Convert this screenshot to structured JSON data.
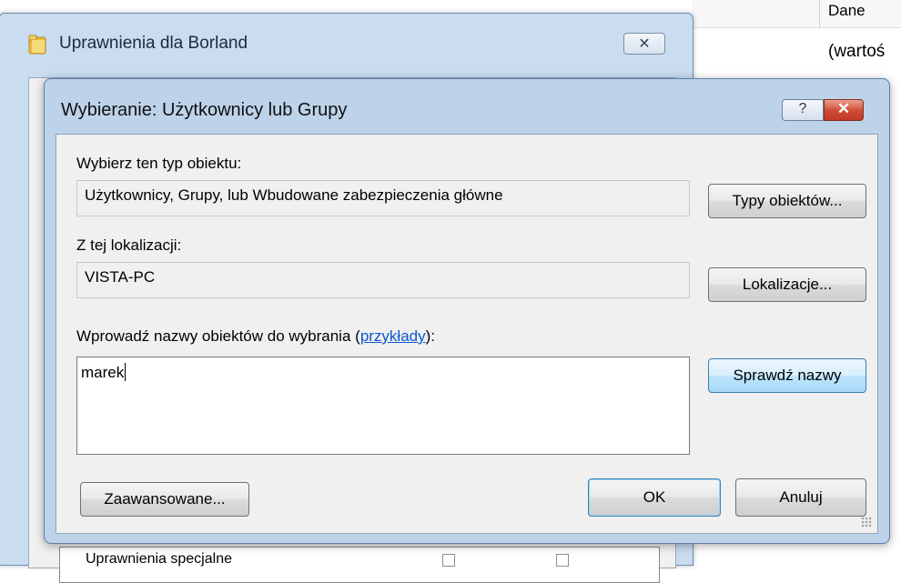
{
  "background_panel": {
    "column_header": "Dane",
    "cell_value": "(wartoś"
  },
  "back_window": {
    "title": "Uprawnienia dla Borland",
    "list_partial_item": "Uprawnienia specjalne"
  },
  "dialog": {
    "title": "Wybieranie: Użytkownicy lub Grupy",
    "object_type_label": "Wybierz ten typ obiektu:",
    "object_type_value": "Użytkownicy, Grupy, lub Wbudowane zabezpieczenia główne",
    "object_types_button": "Typy obiektów...",
    "location_label": "Z tej lokalizacji:",
    "location_value": "VISTA-PC",
    "locations_button": "Lokalizacje...",
    "enter_names_label_prefix": "Wprowadź nazwy obiektów do wybrania (",
    "examples_link": "przykłady",
    "enter_names_label_suffix": "):",
    "names_value": "marek",
    "check_names_button": "Sprawdź nazwy",
    "advanced_button": "Zaawansowane...",
    "ok_button": "OK",
    "cancel_button": "Anuluj"
  },
  "icons": {
    "back_window_title": "folder-icon",
    "back_close": "close-icon",
    "help": "help-icon",
    "close": "close-icon"
  },
  "colors": {
    "frame": "#bdd3ea",
    "close_red": "#c0392a",
    "link": "#0b57d0"
  }
}
